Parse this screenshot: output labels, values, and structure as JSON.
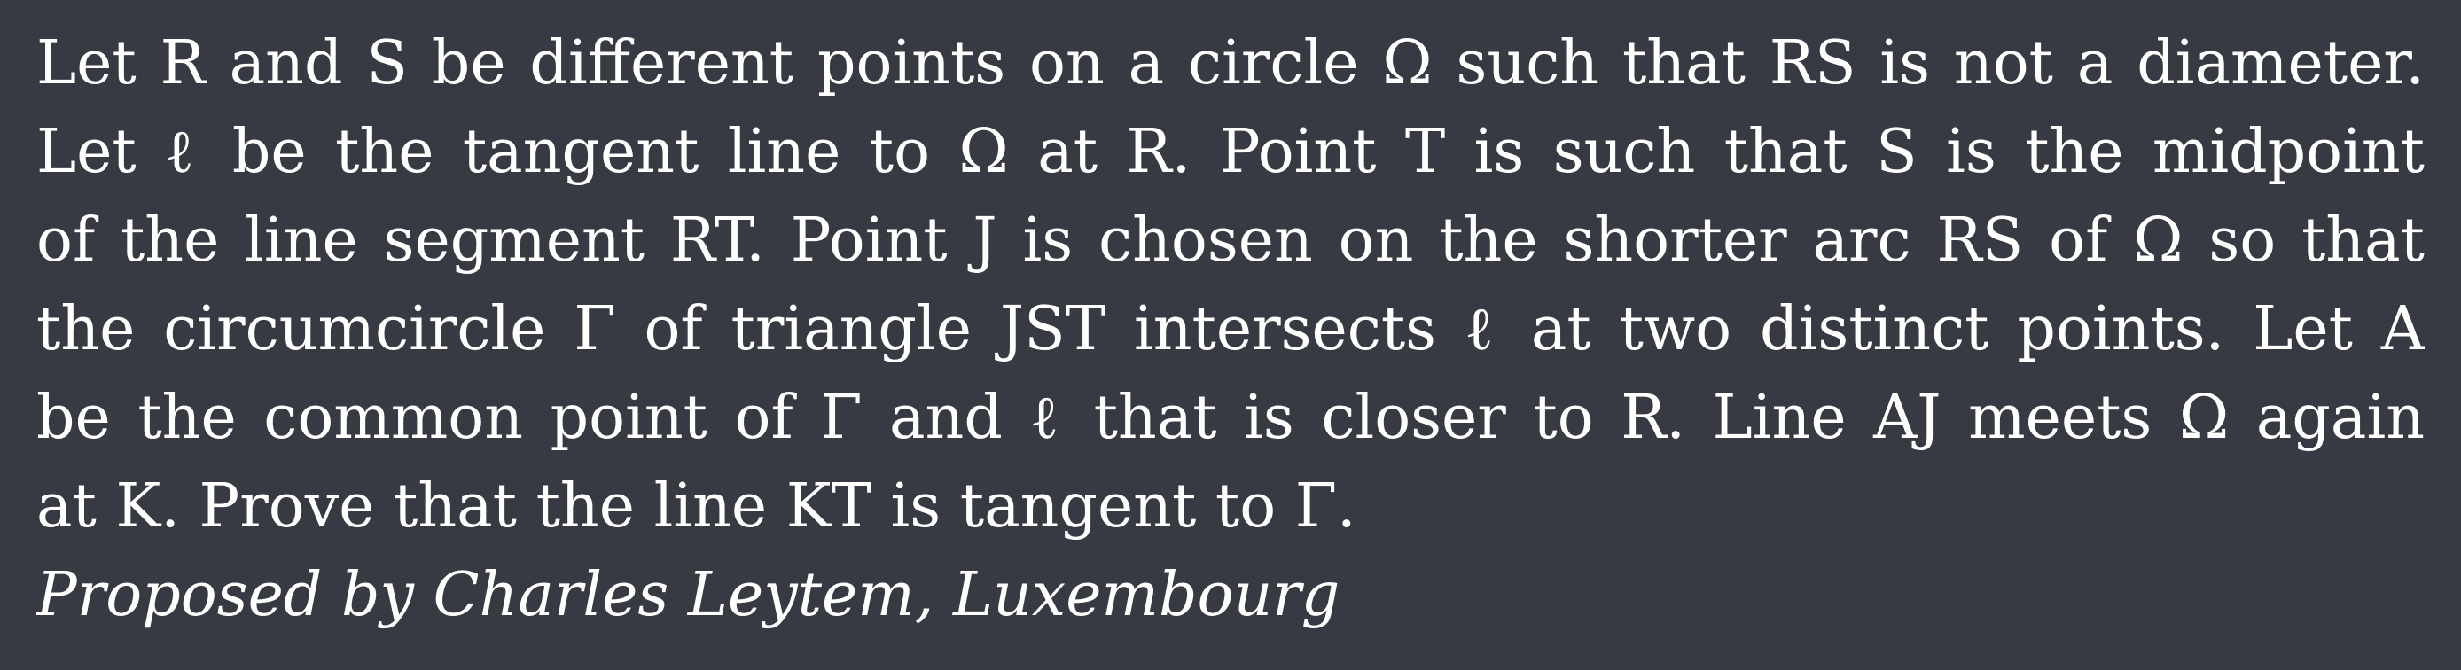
{
  "problem": {
    "lines": [
      "Let R and S be different points on a circle Ω such that RS is not a diameter.",
      "Let ℓ be the tangent line to Ω at R. Point T is such that S is the midpoint",
      "of the line segment RT. Point J is chosen on the shorter arc RS of Ω so that",
      "the circumcircle Γ of triangle JST intersects ℓ at two distinct points. Let A",
      "be the common point of Γ and ℓ that is closer to R. Line AJ meets Ω again",
      "at K. Prove that the line KT is tangent to Γ."
    ],
    "attribution": "Proposed by Charles Leytem, Luxembourg"
  }
}
